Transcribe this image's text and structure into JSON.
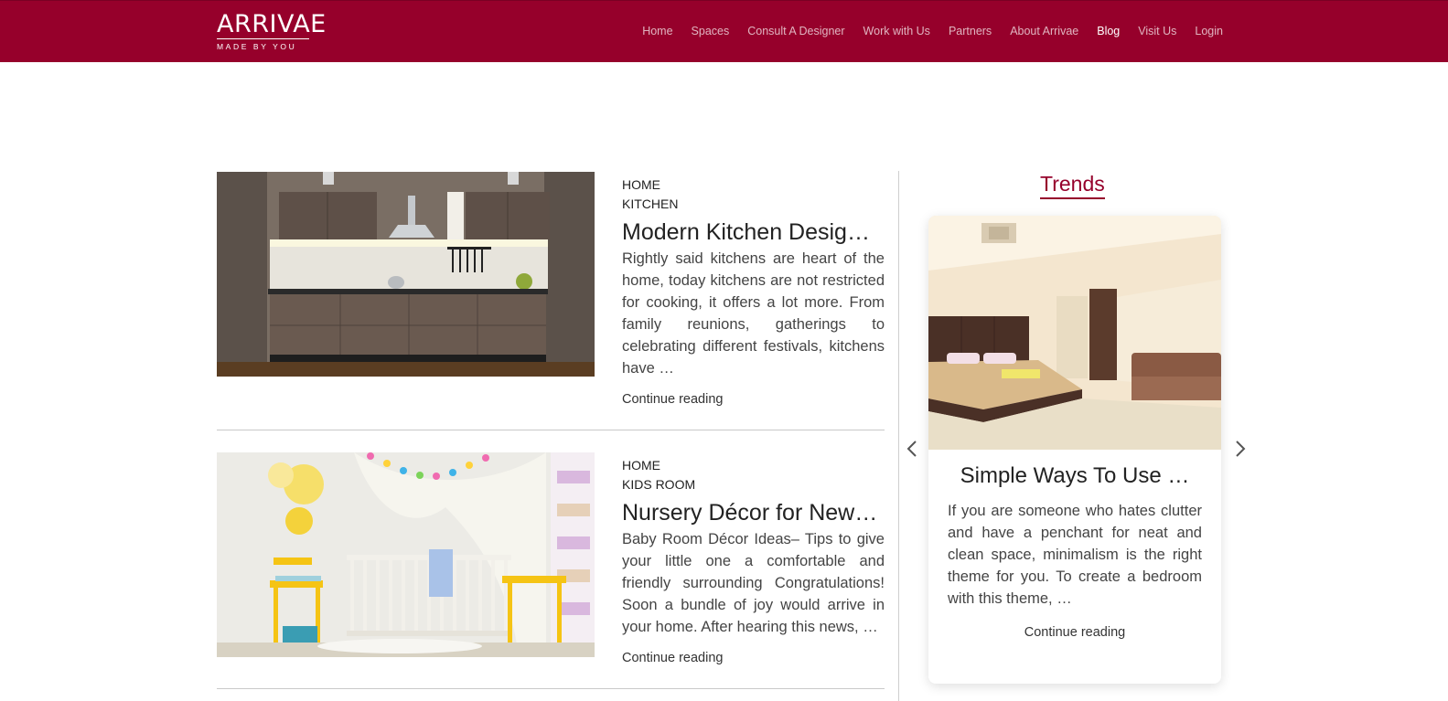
{
  "brand": {
    "name": "ARRIVAE",
    "tagline": "MADE BY YOU"
  },
  "nav": {
    "items": [
      {
        "label": "Home"
      },
      {
        "label": "Spaces"
      },
      {
        "label": "Consult A Designer"
      },
      {
        "label": "Work with Us"
      },
      {
        "label": "Partners"
      },
      {
        "label": "About Arrivae"
      },
      {
        "label": "Blog"
      },
      {
        "label": "Visit Us"
      },
      {
        "label": "Login"
      }
    ],
    "active": "Blog"
  },
  "posts": [
    {
      "categories": [
        "HOME",
        "KITCHEN"
      ],
      "title": "Modern Kitchen Desig…",
      "excerpt": "Rightly said kitchens are heart of the home, today kitchens are not restricted for cooking, it offers a lot more. From family reunions, gatherings to celebrating different festivals, kitchens have …",
      "continue_label": "Continue reading"
    },
    {
      "categories": [
        "HOME",
        "KIDS ROOM"
      ],
      "title": "Nursery Décor for New…",
      "excerpt": "Baby Room Décor Ideas– Tips to give your little one a comfortable and friendly surrounding Congratulations! Soon a bundle of joy would arrive in your home. After hearing this news, …",
      "continue_label": "Continue reading"
    }
  ],
  "trends": {
    "heading": "Trends",
    "card": {
      "title": "Simple Ways To Use …",
      "excerpt": "If you are someone who hates clutter and have a penchant for neat and clean space, minimalism is the right theme for you. To create a bedroom with this theme, …",
      "continue_label": "Continue reading"
    }
  },
  "colors": {
    "brand": "#96002b",
    "text": "#333333"
  },
  "icons": {
    "prev": "chevron-left-icon",
    "next": "chevron-right-icon"
  }
}
